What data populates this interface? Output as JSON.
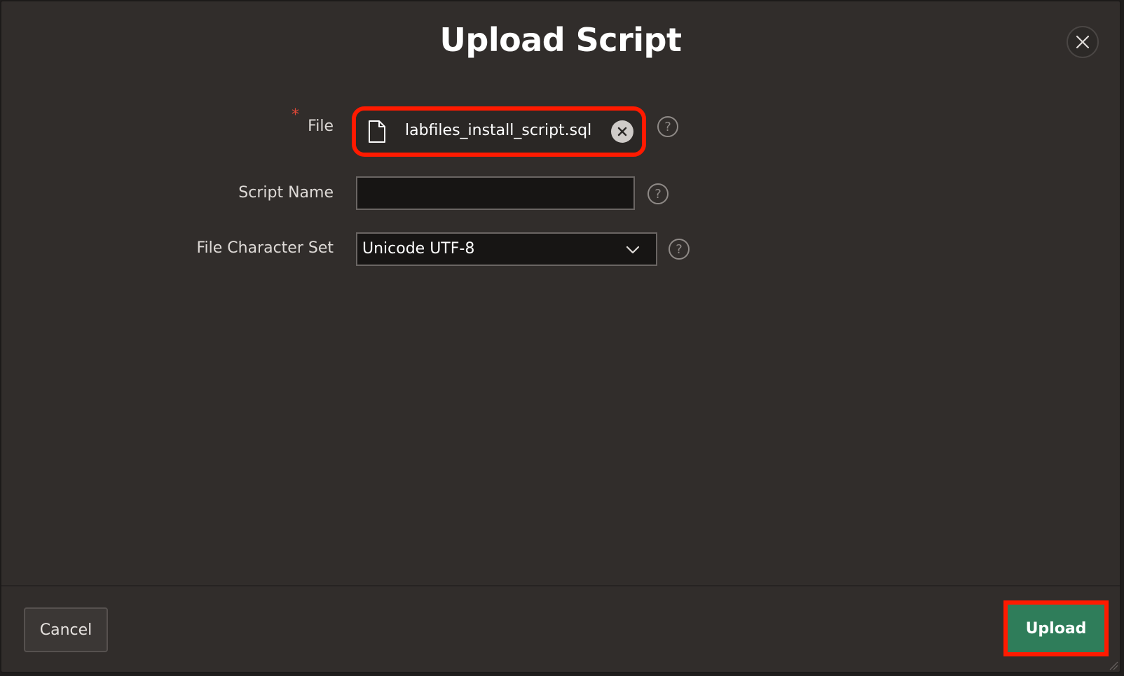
{
  "dialog": {
    "title": "Upload Script"
  },
  "form": {
    "file": {
      "label": "File",
      "required_marker": "*",
      "file_name": "labfiles_install_script.sql",
      "help": "?"
    },
    "script_name": {
      "label": "Script Name",
      "value": "",
      "help": "?"
    },
    "charset": {
      "label": "File Character Set",
      "selected": "Unicode UTF-8",
      "help": "?"
    }
  },
  "footer": {
    "cancel_label": "Cancel",
    "upload_label": "Upload"
  },
  "colors": {
    "background": "#312d2b",
    "highlight": "#ff1a00",
    "primary": "#2f7d5a",
    "required": "#e04838"
  }
}
